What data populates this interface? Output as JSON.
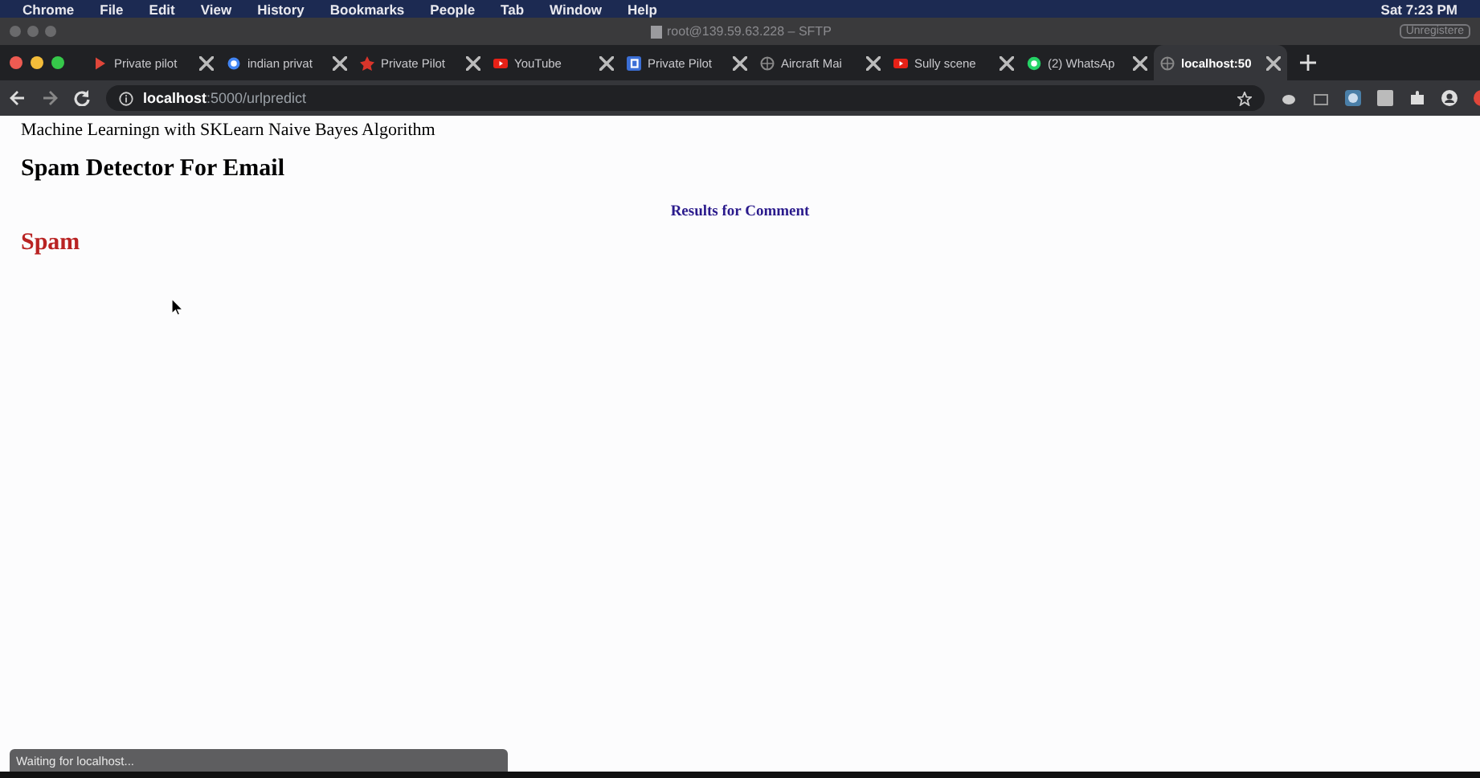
{
  "menu_bar": {
    "items": [
      "Chrome",
      "File",
      "Edit",
      "View",
      "History",
      "Bookmarks",
      "People",
      "Tab",
      "Window",
      "Help"
    ],
    "clock": "Sat 7:23 PM"
  },
  "window": {
    "title": "root@139.59.63.228 – SFTP",
    "badge": "Unregistere"
  },
  "tabs": [
    {
      "label": "Private pilot",
      "kind": "play",
      "selected": false
    },
    {
      "label": "indian privat",
      "kind": "google",
      "selected": false
    },
    {
      "label": "Private Pilot",
      "kind": "star",
      "selected": false
    },
    {
      "label": "YouTube",
      "kind": "video",
      "selected": false
    },
    {
      "label": "Private Pilot",
      "kind": "letter",
      "selected": false
    },
    {
      "label": "Aircraft Mai",
      "kind": "globe",
      "selected": false
    },
    {
      "label": "Sully scene",
      "kind": "video",
      "selected": false
    },
    {
      "label": "(2) WhatsAp",
      "kind": "chat",
      "selected": false
    },
    {
      "label": "localhost:50",
      "kind": "globe",
      "selected": true
    }
  ],
  "address_bar": {
    "host": "localhost",
    "path": ":5000/urlpredict"
  },
  "page": {
    "subtitle": "Machine Learningn with SKLearn Naive Bayes Algorithm",
    "heading": "Spam Detector For Email",
    "results_label": "Results for Comment",
    "result": "Spam"
  },
  "status_bar": "Waiting for localhost..."
}
